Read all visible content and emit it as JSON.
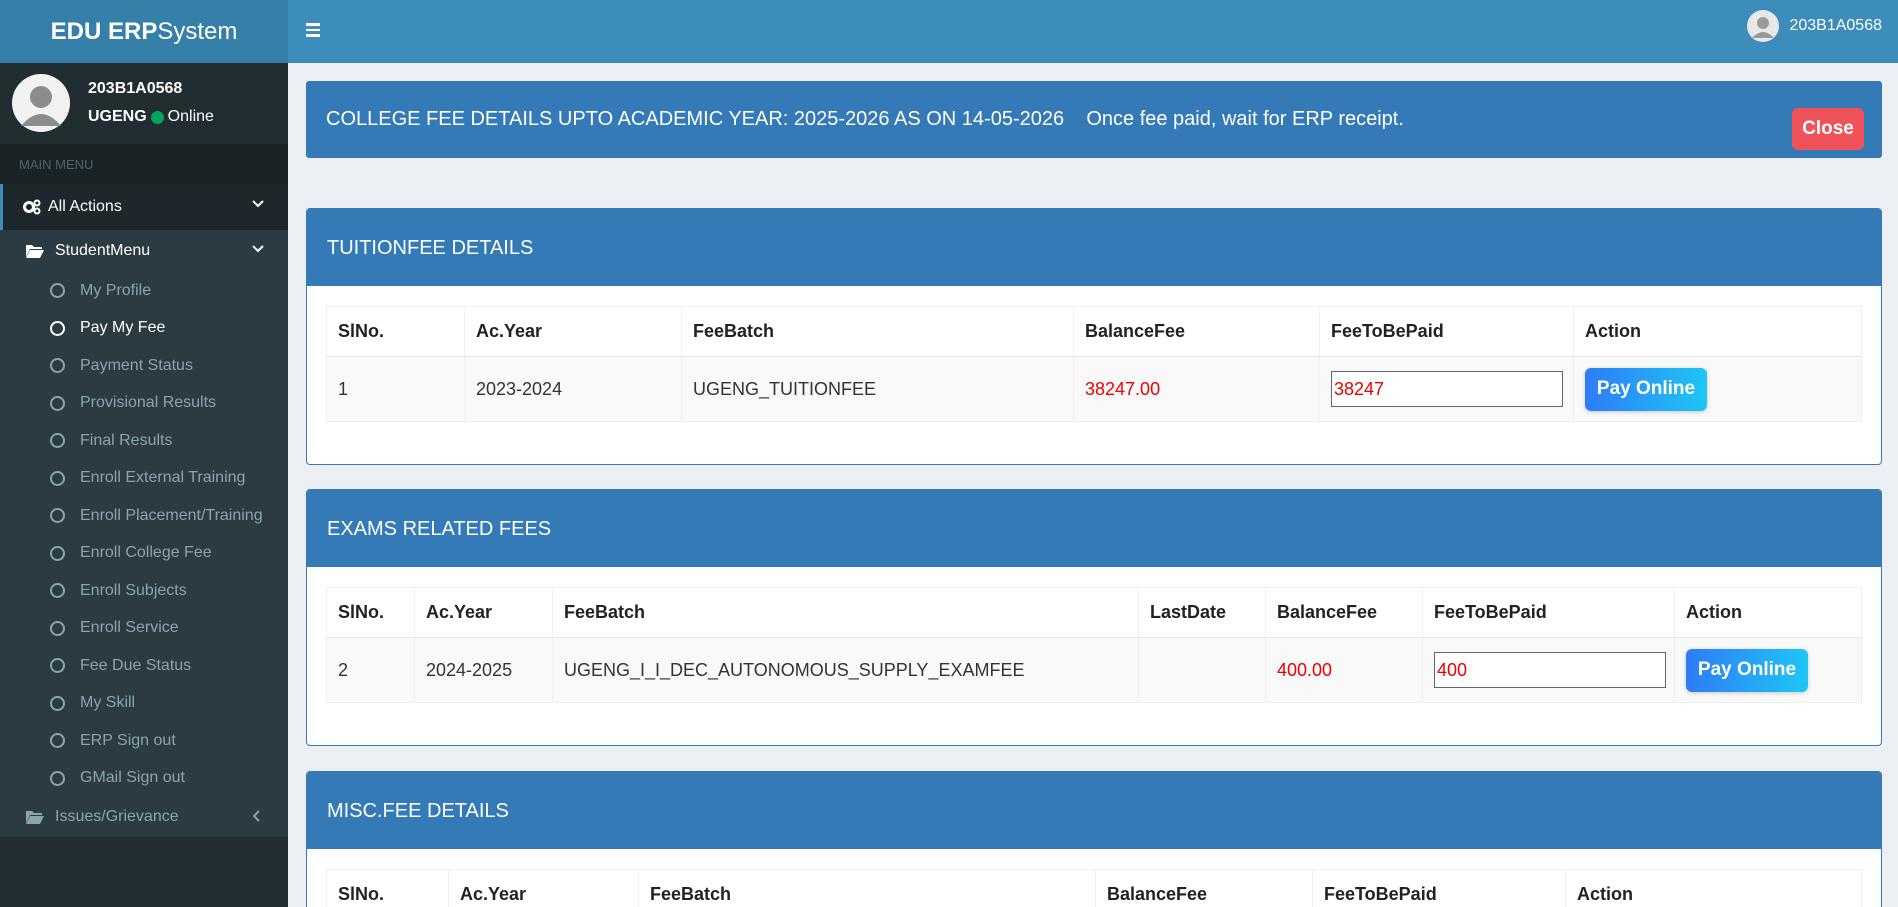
{
  "header": {
    "logo_bold": "EDU ERP",
    "logo_light": "System",
    "username": "203B1A0568"
  },
  "sidebar": {
    "user_id": "203B1A0568",
    "group": "UGENG",
    "status": "Online",
    "section_header": "MAIN MENU",
    "all_actions": "All Actions",
    "student_menu": "StudentMenu",
    "items": [
      {
        "label": "My Profile"
      },
      {
        "label": "Pay My Fee"
      },
      {
        "label": "Payment Status"
      },
      {
        "label": "Provisional Results"
      },
      {
        "label": "Final Results"
      },
      {
        "label": "Enroll External Training"
      },
      {
        "label": "Enroll Placement/Training"
      },
      {
        "label": "Enroll College Fee"
      },
      {
        "label": "Enroll Subjects"
      },
      {
        "label": "Enroll Service"
      },
      {
        "label": "Fee Due Status"
      },
      {
        "label": "My Skill"
      },
      {
        "label": "ERP Sign out"
      },
      {
        "label": "GMail Sign out"
      }
    ],
    "issues": "Issues/Grievance"
  },
  "alert": {
    "text": "COLLEGE FEE DETAILS UPTO ACADEMIC YEAR: 2025-2026 AS ON 14-05-2026    Once fee paid, wait for ERP receipt.",
    "close_label": "Close"
  },
  "tuition": {
    "title": "TUITIONFEE DETAILS",
    "headers": [
      "SlNo.",
      "Ac.Year",
      "FeeBatch",
      "BalanceFee",
      "FeeToBePaid",
      "Action"
    ],
    "row": {
      "slno": "1",
      "year": "2023-2024",
      "batch": "UGENG_TUITIONFEE",
      "balance": "38247.00",
      "to_pay": "38247",
      "action": "Pay Online"
    }
  },
  "exams": {
    "title": "EXAMS RELATED FEES",
    "headers": [
      "SlNo.",
      "Ac.Year",
      "FeeBatch",
      "LastDate",
      "BalanceFee",
      "FeeToBePaid",
      "Action"
    ],
    "row": {
      "slno": "2",
      "year": "2024-2025",
      "batch": "UGENG_I_I_DEC_AUTONOMOUS_SUPPLY_EXAMFEE",
      "last_date": "",
      "balance": "400.00",
      "to_pay": "400",
      "action": "Pay Online"
    }
  },
  "misc": {
    "title": "MISC.FEE DETAILS",
    "headers": [
      "SlNo.",
      "Ac.Year",
      "FeeBatch",
      "BalanceFee",
      "FeeToBePaid",
      "Action"
    ]
  },
  "colors": {
    "primary": "#3c8dbc",
    "panel_blue": "#337ab7",
    "sidebar_dark": "#222d32",
    "close_red": "#f0525a",
    "amount_red": "#ee0000",
    "online_green": "#00a65a"
  }
}
